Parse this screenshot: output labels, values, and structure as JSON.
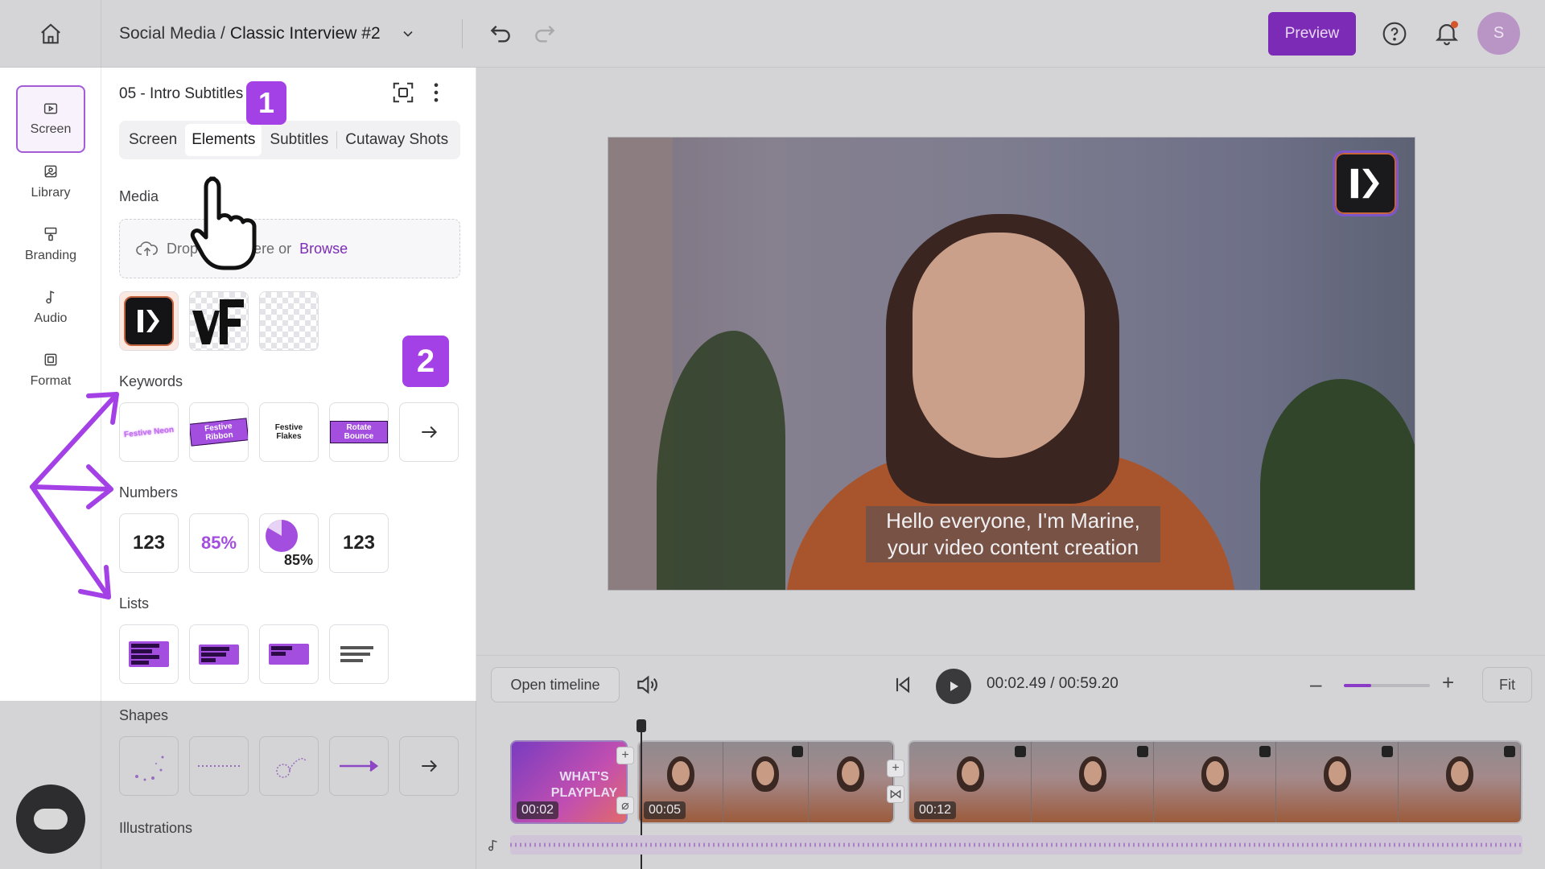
{
  "header": {
    "breadcrumb_parent": "Social Media /",
    "breadcrumb_current": "Classic Interview #2",
    "preview_label": "Preview",
    "avatar_initial": "S"
  },
  "rail": {
    "items": [
      {
        "label": "Screen",
        "icon": "screen-icon",
        "active": true
      },
      {
        "label": "Library",
        "icon": "library-icon"
      },
      {
        "label": "Branding",
        "icon": "branding-icon"
      },
      {
        "label": "Audio",
        "icon": "audio-note-icon"
      },
      {
        "label": "Format",
        "icon": "format-icon"
      }
    ]
  },
  "panel": {
    "scene_title": "05 - Intro Subtitles",
    "tabs": [
      "Screen",
      "Elements",
      "Subtitles",
      "Cutaway Shots"
    ],
    "active_tab": "Elements",
    "media": {
      "label": "Media",
      "drop_text": "Drop media here or",
      "browse": "Browse"
    },
    "keywords": {
      "label": "Keywords",
      "items": [
        "Festive Neon",
        "Festive Ribbon",
        "Festive Flakes",
        "Rotate Bounce"
      ]
    },
    "numbers": {
      "label": "Numbers",
      "items": [
        "123",
        "85%",
        "85%",
        "123"
      ]
    },
    "lists": {
      "label": "Lists",
      "item_line_1": "Text on one line",
      "item_line_2": "Text on several lines",
      "item_line_3": "Short text"
    },
    "shapes": {
      "label": "Shapes"
    },
    "illustrations": {
      "label": "Illustrations"
    }
  },
  "video": {
    "subtitle_line_1": "Hello everyone, I'm Marine,",
    "subtitle_line_2": "your video content creation"
  },
  "playback": {
    "open_timeline": "Open timeline",
    "timecode": "00:02.49 / 00:59.20",
    "fit": "Fit",
    "zoom_fraction": 0.32
  },
  "timeline": {
    "clips": [
      {
        "time": "00:02",
        "label": "WHAT'S PLAYPLAY"
      },
      {
        "time": "00:05"
      },
      {
        "time": "00:12"
      }
    ]
  },
  "annotations": {
    "badge_1": "1",
    "badge_2": "2"
  },
  "colors": {
    "accent": "#7b2bb5",
    "badge": "#a340e6",
    "keyword_chip": "#a44ee0"
  }
}
